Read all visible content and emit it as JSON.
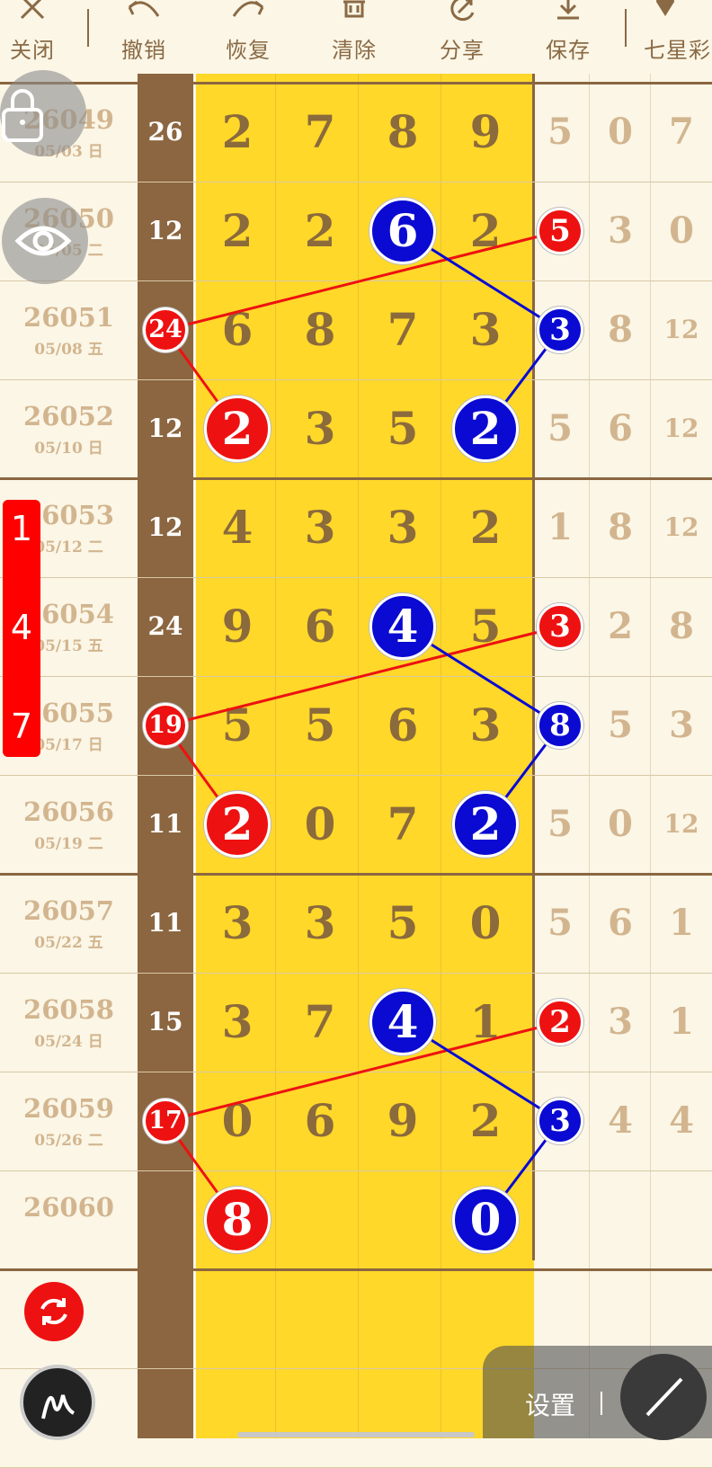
{
  "toolbar": {
    "close": "关闭",
    "undo": "撤销",
    "redo": "恢复",
    "clear": "清除",
    "share": "分享",
    "save": "保存",
    "lottery": "七星彩"
  },
  "rows": [
    {
      "id": "26049",
      "date": "05/03 日",
      "sum": "26",
      "digits": [
        "2",
        "7",
        "8",
        "9"
      ],
      "tail": [
        "5",
        "0",
        "7"
      ]
    },
    {
      "id": "26050",
      "date": "05/05 二",
      "sum": "12",
      "digits": [
        "2",
        "2",
        "6",
        "2"
      ],
      "tail": [
        "5",
        "3",
        "0"
      ]
    },
    {
      "id": "26051",
      "date": "05/08 五",
      "sum": "24",
      "digits": [
        "6",
        "8",
        "7",
        "3"
      ],
      "tail": [
        "3",
        "8",
        "12"
      ]
    },
    {
      "id": "26052",
      "date": "05/10 日",
      "sum": "12",
      "digits": [
        "2",
        "3",
        "5",
        "2"
      ],
      "tail": [
        "5",
        "6",
        "12"
      ]
    },
    {
      "id": "26053",
      "date": "05/12 二",
      "sum": "12",
      "digits": [
        "4",
        "3",
        "3",
        "2"
      ],
      "tail": [
        "1",
        "8",
        "12"
      ]
    },
    {
      "id": "26054",
      "date": "05/15 五",
      "sum": "24",
      "digits": [
        "9",
        "6",
        "4",
        "5"
      ],
      "tail": [
        "3",
        "2",
        "8"
      ]
    },
    {
      "id": "26055",
      "date": "05/17 日",
      "sum": "19",
      "digits": [
        "5",
        "5",
        "6",
        "3"
      ],
      "tail": [
        "8",
        "5",
        "3"
      ]
    },
    {
      "id": "26056",
      "date": "05/19 二",
      "sum": "11",
      "digits": [
        "2",
        "0",
        "7",
        "2"
      ],
      "tail": [
        "5",
        "0",
        "12"
      ]
    },
    {
      "id": "26057",
      "date": "05/22 五",
      "sum": "11",
      "digits": [
        "3",
        "3",
        "5",
        "0"
      ],
      "tail": [
        "5",
        "6",
        "1"
      ]
    },
    {
      "id": "26058",
      "date": "05/24 日",
      "sum": "15",
      "digits": [
        "3",
        "7",
        "4",
        "1"
      ],
      "tail": [
        "2",
        "3",
        "1"
      ]
    },
    {
      "id": "26059",
      "date": "05/26 二",
      "sum": "17",
      "digits": [
        "0",
        "6",
        "9",
        "2"
      ],
      "tail": [
        "3",
        "4",
        "4"
      ]
    },
    {
      "id": "26060",
      "date": "",
      "sum": "",
      "digits": [
        "8",
        "",
        "",
        "0"
      ],
      "tail": [
        "",
        "",
        ""
      ]
    }
  ],
  "marks": [
    {
      "row": 1,
      "col": "d2",
      "value": "6",
      "color": "blue"
    },
    {
      "row": 1,
      "col": "t0",
      "value": "5",
      "color": "red"
    },
    {
      "row": 2,
      "col": "sum",
      "value": "24",
      "color": "red"
    },
    {
      "row": 2,
      "col": "t0",
      "value": "3",
      "color": "blue"
    },
    {
      "row": 3,
      "col": "d0",
      "value": "2",
      "color": "red"
    },
    {
      "row": 3,
      "col": "d3",
      "value": "2",
      "color": "blue"
    },
    {
      "row": 5,
      "col": "d2",
      "value": "4",
      "color": "blue"
    },
    {
      "row": 5,
      "col": "t0",
      "value": "3",
      "color": "red"
    },
    {
      "row": 6,
      "col": "sum",
      "value": "19",
      "color": "red"
    },
    {
      "row": 6,
      "col": "t0",
      "value": "8",
      "color": "blue"
    },
    {
      "row": 7,
      "col": "d0",
      "value": "2",
      "color": "red"
    },
    {
      "row": 7,
      "col": "d3",
      "value": "2",
      "color": "blue"
    },
    {
      "row": 9,
      "col": "d2",
      "value": "4",
      "color": "blue"
    },
    {
      "row": 9,
      "col": "t0",
      "value": "2",
      "color": "red"
    },
    {
      "row": 10,
      "col": "sum",
      "value": "17",
      "color": "red"
    },
    {
      "row": 10,
      "col": "t0",
      "value": "3",
      "color": "blue"
    },
    {
      "row": 11,
      "col": "d0",
      "value": "8",
      "color": "red"
    },
    {
      "row": 11,
      "col": "d3",
      "value": "0",
      "color": "blue"
    }
  ],
  "side_tab": [
    "1",
    "4",
    "7"
  ],
  "settings": {
    "label": "设置"
  },
  "icons": [
    "close-icon",
    "undo-icon",
    "redo-icon",
    "trash-icon",
    "share-icon",
    "download-icon",
    "pin-icon",
    "lock-icon",
    "eye-icon",
    "refresh-icon",
    "pen-icon",
    "line-tool-icon"
  ],
  "colors": {
    "background": "#fbf6e6",
    "highlight": "#ffd829",
    "sum_column": "#8b6640",
    "red_ball": "#ee1111",
    "blue_ball": "#0a0ad2",
    "digit": "#8b6a3c",
    "faded": "#d2b58f"
  }
}
